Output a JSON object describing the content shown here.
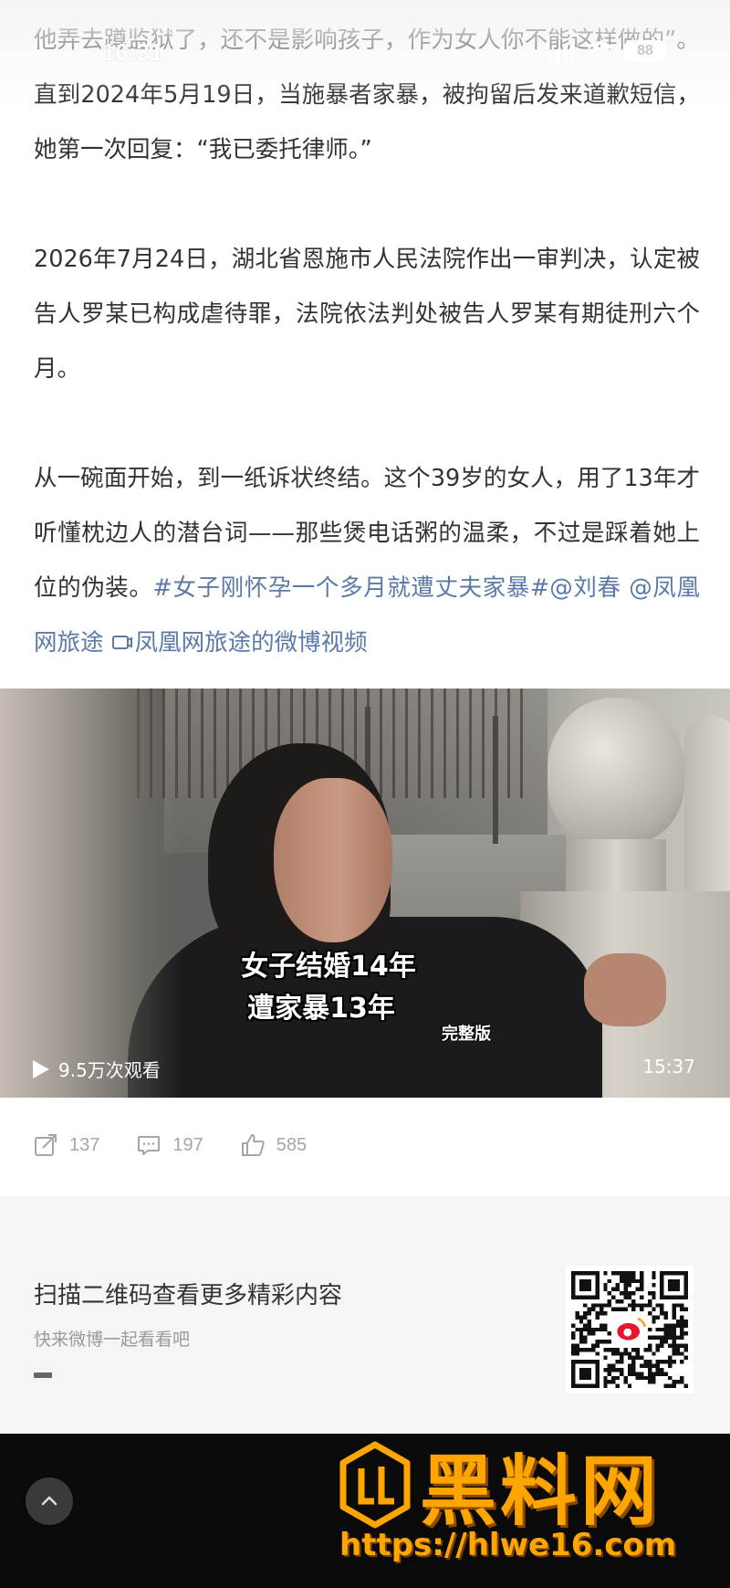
{
  "status_bar": {
    "time": "16:31",
    "battery": "88",
    "signal_icon": "signal-icon",
    "wifi_icon": "wifi-icon"
  },
  "article": {
    "paragraphs": [
      {
        "text": "他弄去蹲监狱了，还不是影响孩子，作为女人你不能这样做的”。直到2024年5月19日，当施暴者家暴，被拘留后发来道歉短信，她第一次回复：“我已委托律师。”"
      },
      {
        "text": "2026年7月24日，湖北省恩施市人民法院作出一审判决，认定被告人罗某已构成虐待罪，法院依法判处被告人罗某有期徒刑六个月。"
      },
      {
        "text": "从一碗面开始，到一纸诉状终结。这个39岁的女人，用了13年才听懂枕边人的潜台词——那些煲电话粥的温柔，不过是踩着她上位的伪装。",
        "hashtag": "#女子刚怀孕一个多月就遭丈夫家暴#",
        "mention1": "@刘春",
        "mention2": "@凤凰网旅途",
        "video_link": "凤凰网旅途的微博视频",
        "video_link_icon": "video-link-icon"
      }
    ]
  },
  "video": {
    "caption_line1": "女子结婚14年",
    "caption_line2": "遭家暴13年",
    "tag": "完整版",
    "views": "9.5万次观看",
    "duration": "15:37",
    "play_icon": "play-icon"
  },
  "actions": {
    "repost_count": "137",
    "comment_count": "197",
    "like_count": "585",
    "repost_icon": "repost-icon",
    "comment_icon": "comment-icon",
    "like_icon": "like-icon"
  },
  "qr_panel": {
    "title": "扫描二维码查看更多精彩内容",
    "subtitle": "快来微博一起看看吧",
    "qr_icon": "qr-code-icon"
  },
  "bottom_bar": {
    "scroll_top_icon": "chevron-up-icon"
  },
  "site_watermark": {
    "logo_text": "黑料网",
    "url": "https://hlwe16.com",
    "accent_color": "#ffa500"
  },
  "colors": {
    "text": "#333333",
    "link": "#5b7aa8",
    "muted": "#a6a6a6",
    "panel": "#f5f5f5",
    "bottom": "#0a0a0a"
  }
}
